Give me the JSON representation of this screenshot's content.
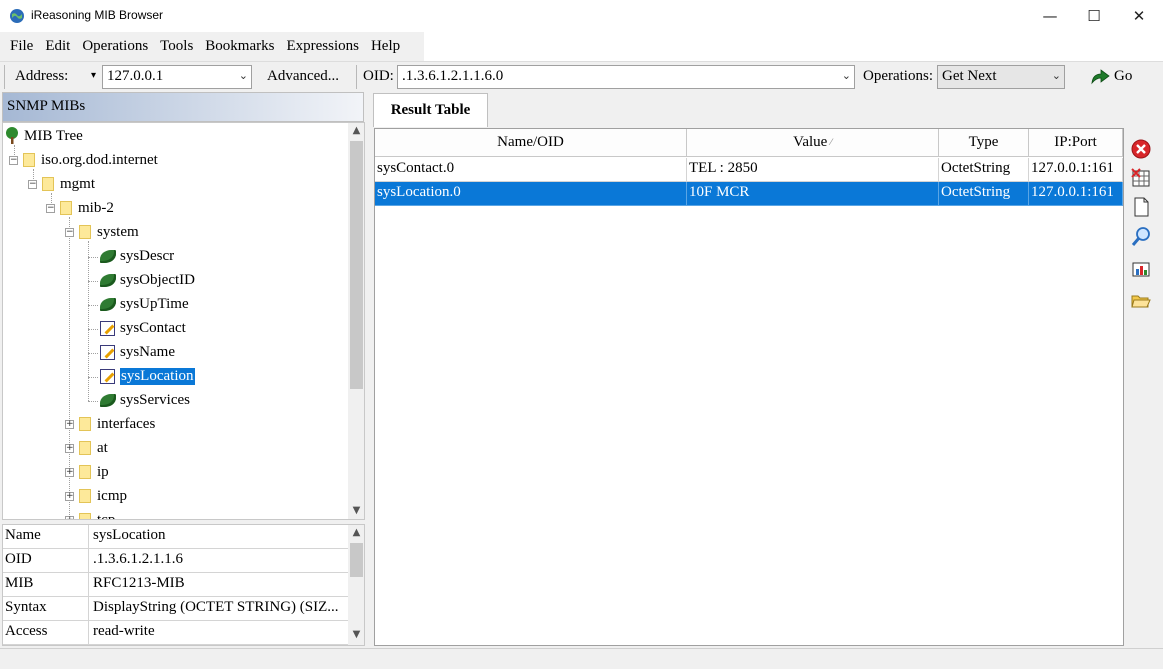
{
  "window": {
    "title": "iReasoning MIB Browser",
    "controls": {
      "minimize": "—",
      "maximize": "☐",
      "close": "✕"
    }
  },
  "menu": [
    "File",
    "Edit",
    "Operations",
    "Tools",
    "Bookmarks",
    "Expressions",
    "Help"
  ],
  "toolbar": {
    "address_label": "Address:",
    "address_value": "127.0.0.1",
    "advanced_label": "Advanced...",
    "oid_label": "OID:",
    "oid_value": ".1.3.6.1.2.1.1.6.0",
    "operations_label": "Operations:",
    "operations_value": "Get Next",
    "go_label": "Go"
  },
  "left_panel": {
    "header": "SNMP MIBs",
    "tree": {
      "root": "MIB Tree",
      "internet": "iso.org.dod.internet",
      "mgmt": "mgmt",
      "mib2": "mib-2",
      "system": "system",
      "system_children": [
        "sysDescr",
        "sysObjectID",
        "sysUpTime",
        "sysContact",
        "sysName",
        "sysLocation",
        "sysServices"
      ],
      "siblings": [
        "interfaces",
        "at",
        "ip",
        "icmp",
        "tcp"
      ]
    },
    "selected": "sysLocation",
    "properties": [
      {
        "key": "Name",
        "value": "sysLocation"
      },
      {
        "key": "OID",
        "value": ".1.3.6.1.2.1.1.6"
      },
      {
        "key": "MIB",
        "value": "RFC1213-MIB"
      },
      {
        "key": "Syntax",
        "value": "DisplayString (OCTET STRING) (SIZ..."
      },
      {
        "key": "Access",
        "value": "read-write"
      }
    ]
  },
  "result": {
    "tab": "Result Table",
    "columns": [
      "Name/OID",
      "Value",
      "Type",
      "IP:Port"
    ],
    "rows": [
      {
        "name": "sysContact.0",
        "value": "TEL : 2850",
        "type": "OctetString",
        "ipport": "127.0.0.1:161",
        "selected": false
      },
      {
        "name": "sysLocation.0",
        "value": "10F MCR",
        "type": "OctetString",
        "ipport": "127.0.0.1:161",
        "selected": true
      }
    ]
  },
  "side_tools": [
    "delete-icon",
    "remove-all-icon",
    "new-page-icon",
    "search-icon",
    "graph-icon",
    "open-folder-icon"
  ],
  "colors": {
    "selection": "#0a78d7",
    "header_gradient": "#a5b8d4"
  }
}
